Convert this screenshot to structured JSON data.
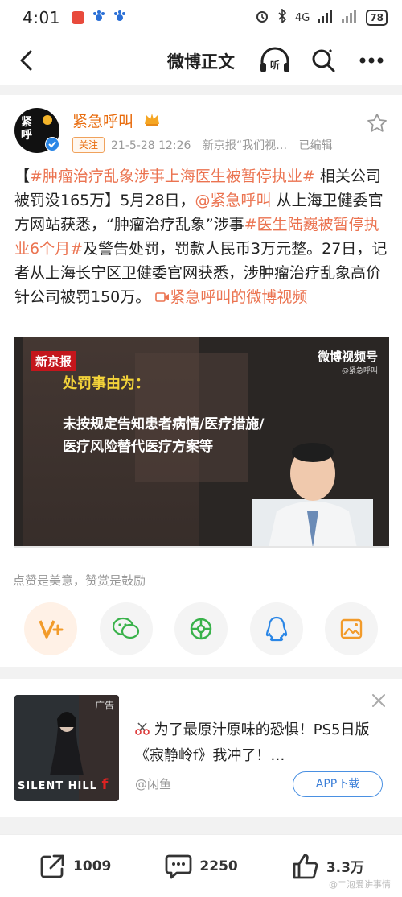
{
  "status_bar": {
    "time": "4:01",
    "network_label": "4G",
    "battery": "78"
  },
  "nav": {
    "title": "微博正文"
  },
  "post": {
    "author": "紧急呼叫",
    "follow_label": "关注",
    "time": "21-5-28 12:26",
    "source": "新京报“我们视…",
    "edited": "已编辑",
    "text": {
      "tag1": "#肿瘤治疗乱象涉事上海医生被暂停执业#",
      "seg1": " 相关公司被罚没165万】5月28日，",
      "mention": "@紧急呼叫",
      "seg2": " 从上海卫健委官方网站获悉，“肿瘤治疗乱象”涉事",
      "tag2": "#医生陆巍被暂停执业6个月#",
      "seg3": "及警告处罚，罚款人民币3万元整。27日，记者从上海长宁区卫健委官网获悉，涉肿瘤治疗乱象高价针公司被罚150万。",
      "video_link": "紧急呼叫的微博视频"
    },
    "video": {
      "logo": "新京报",
      "brand": "微博视频号",
      "brand_sub": "@紧急呼叫",
      "caption_title": "处罚事由为：",
      "caption_line1": "未按规定告知患者病情/医疗措施/",
      "caption_line2": "医疗风险替代医疗方案等",
      "progress": 0
    },
    "reward_hint": "点赞是美意，赞赏是鼓励"
  },
  "ad": {
    "tag": "广告",
    "game_name": "SILENT HILL",
    "game_letter": "f",
    "title": "为了最原汁原味的恐惧！PS5日版《寂静岭f》我冲了！…",
    "source": "@闲鱼",
    "button": "APP下载"
  },
  "bottom": {
    "share_count": "1009",
    "comment_count": "2250",
    "like_count": "3.3万"
  },
  "watermark": "@二泡爱讲事情",
  "colors": {
    "accent": "#eb7350",
    "username": "#e86b0c",
    "ad_button": "#3a7ed8"
  }
}
